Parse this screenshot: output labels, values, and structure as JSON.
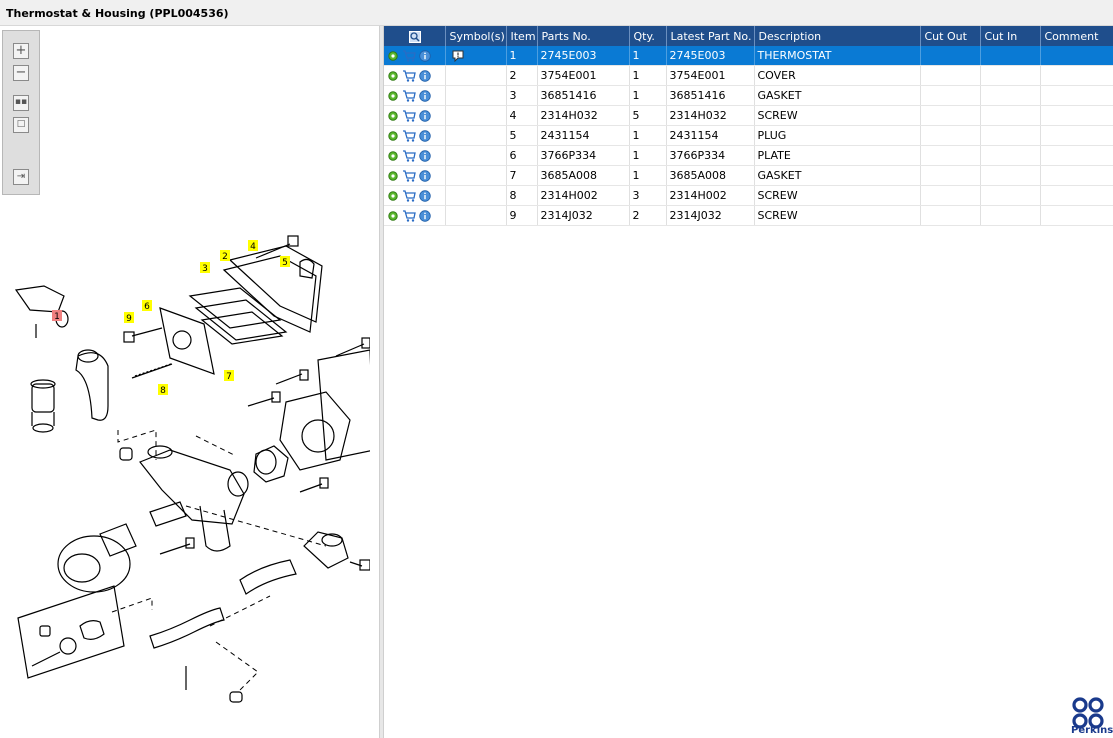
{
  "window": {
    "title": "Thermostat & Housing (PPL004536)"
  },
  "toolbox": {
    "icons": [
      "zoom-in-icon",
      "zoom-out-icon",
      "fit-all-icon",
      "actual-size-icon",
      "export-icon"
    ]
  },
  "callouts": [
    "1",
    "2",
    "3",
    "4",
    "5",
    "6",
    "7",
    "8",
    "9"
  ],
  "table": {
    "columns": [
      "",
      "Symbol(s)",
      "Item",
      "Parts No.",
      "Qty.",
      "Latest Part No.",
      "Description",
      "Cut Out",
      "Cut In",
      "Comment"
    ],
    "rows": [
      {
        "item": "1",
        "parts_no": "2745E003",
        "qty": "1",
        "latest": "2745E003",
        "desc": "THERMOSTAT",
        "cut_out": "",
        "cut_in": "",
        "comment": ""
      },
      {
        "item": "2",
        "parts_no": "3754E001",
        "qty": "1",
        "latest": "3754E001",
        "desc": "COVER",
        "cut_out": "",
        "cut_in": "",
        "comment": ""
      },
      {
        "item": "3",
        "parts_no": "36851416",
        "qty": "1",
        "latest": "36851416",
        "desc": "GASKET",
        "cut_out": "",
        "cut_in": "",
        "comment": ""
      },
      {
        "item": "4",
        "parts_no": "2314H032",
        "qty": "5",
        "latest": "2314H032",
        "desc": "SCREW",
        "cut_out": "",
        "cut_in": "",
        "comment": ""
      },
      {
        "item": "5",
        "parts_no": "2431154",
        "qty": "1",
        "latest": "2431154",
        "desc": "PLUG",
        "cut_out": "",
        "cut_in": "",
        "comment": ""
      },
      {
        "item": "6",
        "parts_no": "3766P334",
        "qty": "1",
        "latest": "3766P334",
        "desc": "PLATE",
        "cut_out": "",
        "cut_in": "",
        "comment": ""
      },
      {
        "item": "7",
        "parts_no": "3685A008",
        "qty": "1",
        "latest": "3685A008",
        "desc": "GASKET",
        "cut_out": "",
        "cut_in": "",
        "comment": ""
      },
      {
        "item": "8",
        "parts_no": "2314H002",
        "qty": "3",
        "latest": "2314H002",
        "desc": "SCREW",
        "cut_out": "",
        "cut_in": "",
        "comment": ""
      },
      {
        "item": "9",
        "parts_no": "2314J032",
        "qty": "2",
        "latest": "2314J032",
        "desc": "SCREW",
        "cut_out": "",
        "cut_in": "",
        "comment": ""
      }
    ]
  },
  "brand": {
    "name": "Perkins"
  },
  "colors": {
    "header": "#1f4e8c",
    "selected": "#0a7ad4",
    "callout": "#ffff00",
    "callout_selected": "#f08080"
  }
}
